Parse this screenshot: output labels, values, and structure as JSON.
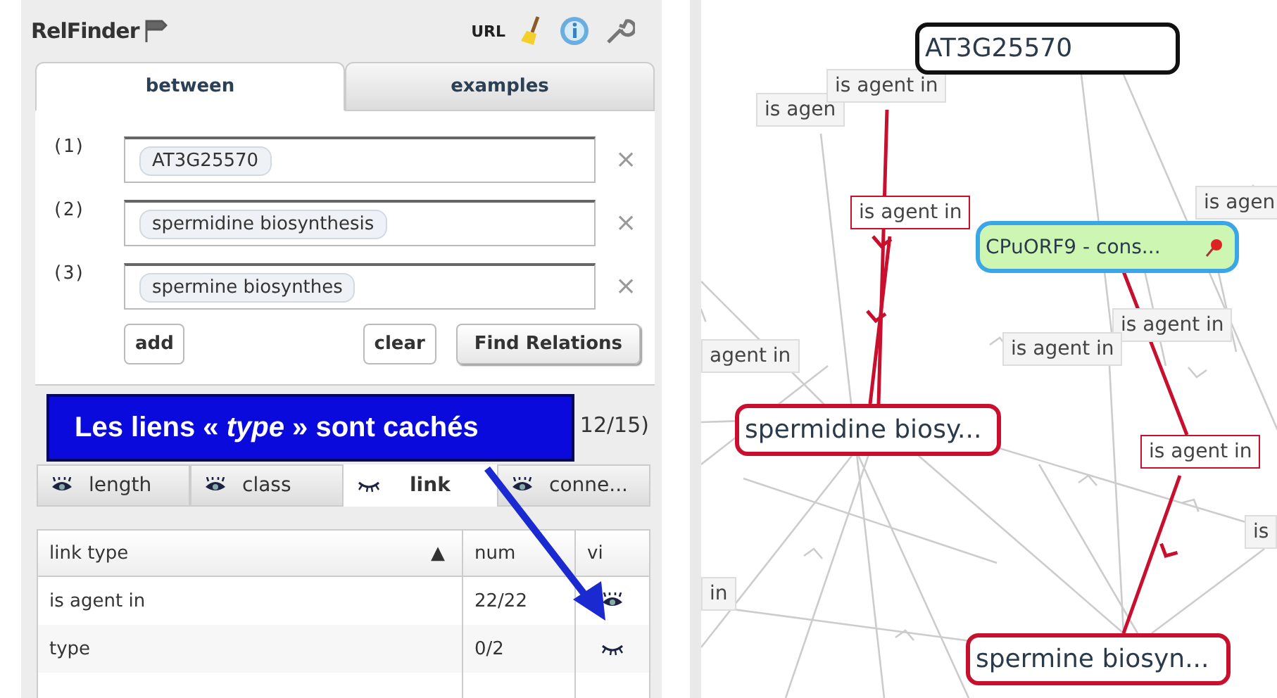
{
  "app": {
    "title": "RelFinder"
  },
  "toolbar": [
    {
      "kind": "url",
      "label": "URL"
    },
    {
      "kind": "broom"
    },
    {
      "kind": "info"
    },
    {
      "kind": "wrench"
    }
  ],
  "tabs": [
    {
      "label": "between",
      "selected": true
    },
    {
      "label": "examples",
      "selected": false
    }
  ],
  "inputs": [
    {
      "number": "(1)",
      "value": "AT3G25570",
      "remove": "×"
    },
    {
      "number": "(2)",
      "value": "spermidine biosynthesis",
      "remove": "×"
    },
    {
      "number": "(3)",
      "value": "spermine biosynthes",
      "remove": "×"
    }
  ],
  "buttons": [
    "add",
    "clear",
    "Find Relations"
  ],
  "filter": {
    "count": "12/15)",
    "tabs": [
      {
        "label": "length",
        "selected": false,
        "visible": true
      },
      {
        "label": "class",
        "selected": false,
        "visible": true
      },
      {
        "label": "link",
        "selected": true,
        "visible": false
      },
      {
        "label": "conne...",
        "selected": false,
        "visible": true
      }
    ]
  },
  "link_table": {
    "columns": [
      "link type",
      "num",
      "vi"
    ],
    "sort": "▲",
    "rows": [
      {
        "link_type": "is agent in",
        "num": "22/22",
        "visible": true
      },
      {
        "link_type": "type",
        "num": "0/2",
        "visible": false
      }
    ]
  },
  "callout": {
    "text": "Les liens « *type* » sont cachés"
  },
  "graph": {
    "nodes": [
      {
        "label": "AT3G25570",
        "kind": "selected"
      },
      {
        "label": "CPuORF9 - cons...",
        "kind": "focus",
        "pinned": true
      },
      {
        "label": "spermidine biosy...",
        "kind": "highlighted"
      },
      {
        "label": "spermine biosyn...",
        "kind": "highlighted"
      }
    ],
    "edge_labels": [
      {
        "label": "is agen",
        "highlighted": false
      },
      {
        "label": "is agent in",
        "highlighted": false
      },
      {
        "label": "is agent in",
        "highlighted": true
      },
      {
        "label": "is agen",
        "highlighted": false
      },
      {
        "label": "agent in",
        "highlighted": false
      },
      {
        "label": "is agent in",
        "highlighted": false
      },
      {
        "label": "is agent in",
        "highlighted": false
      },
      {
        "label": "is agent in",
        "highlighted": true
      },
      {
        "label": "is",
        "highlighted": false
      },
      {
        "label": "in",
        "highlighted": false
      }
    ]
  }
}
